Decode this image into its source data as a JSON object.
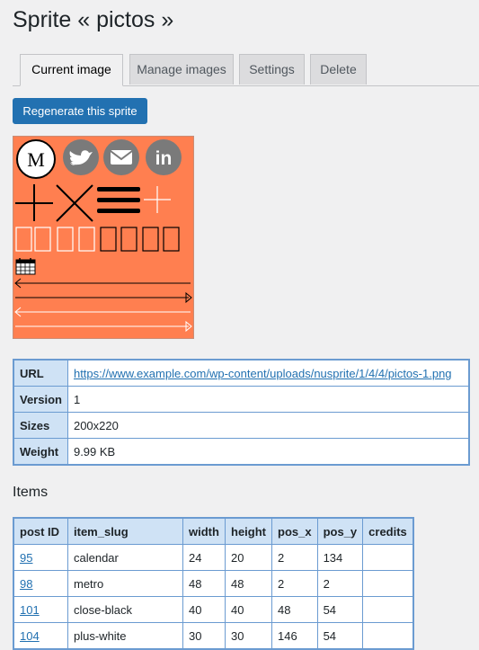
{
  "page": {
    "title": "Sprite « pictos »"
  },
  "tabs": [
    {
      "label": "Current image",
      "active": true
    },
    {
      "label": "Manage images",
      "active": false
    },
    {
      "label": "Settings",
      "active": false
    },
    {
      "label": "Delete",
      "active": false
    }
  ],
  "actions": {
    "regenerate_label": "Regenerate this sprite"
  },
  "sprite": {
    "background": "#ff7f50",
    "icons": [
      "metro-icon",
      "twitter-icon",
      "mail-icon",
      "linkedin-icon",
      "plus-icon",
      "close-icon",
      "hamburger-menu-icon",
      "plus-thin-icon",
      "calendar-icon",
      "arrow-left-icon",
      "arrow-right-icon"
    ]
  },
  "info": {
    "url_label": "URL",
    "url_value": "https://www.example.com/wp-content/uploads/nusprite/1/4/4/pictos-1.png",
    "version_label": "Version",
    "version_value": "1",
    "sizes_label": "Sizes",
    "sizes_value": "200x220",
    "weight_label": "Weight",
    "weight_value": "9.99 KB"
  },
  "items": {
    "title": "Items",
    "headers": [
      "post ID",
      "item_slug",
      "width",
      "height",
      "pos_x",
      "pos_y",
      "credits"
    ],
    "rows": [
      {
        "post_id": "95",
        "item_slug": "calendar",
        "width": "24",
        "height": "20",
        "pos_x": "2",
        "pos_y": "134",
        "credits": ""
      },
      {
        "post_id": "98",
        "item_slug": "metro",
        "width": "48",
        "height": "48",
        "pos_x": "2",
        "pos_y": "2",
        "credits": ""
      },
      {
        "post_id": "101",
        "item_slug": "close-black",
        "width": "40",
        "height": "40",
        "pos_x": "48",
        "pos_y": "54",
        "credits": ""
      },
      {
        "post_id": "104",
        "item_slug": "plus-white",
        "width": "30",
        "height": "30",
        "pos_x": "146",
        "pos_y": "54",
        "credits": ""
      }
    ]
  }
}
